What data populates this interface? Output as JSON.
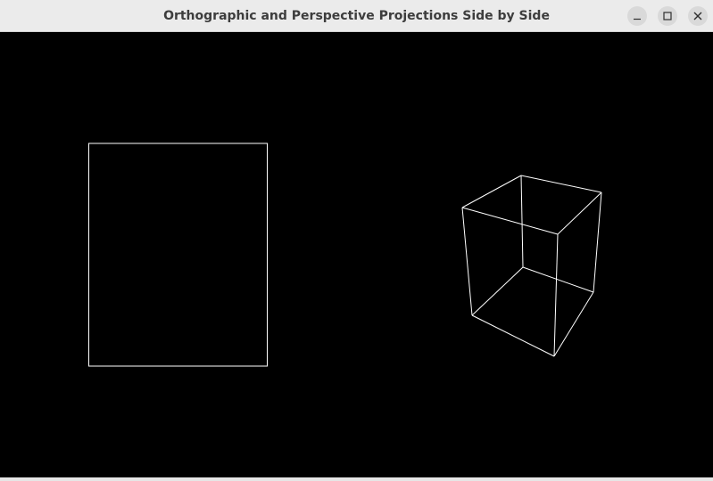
{
  "window": {
    "title": "Orthographic and Perspective Projections Side by Side"
  },
  "controls": {
    "minimize_icon": "minimize-icon",
    "maximize_icon": "maximize-icon",
    "close_icon": "close-icon"
  },
  "scene": {
    "background_color": "#000000",
    "line_color": "#ffffff",
    "left_view": "orthographic-projection",
    "right_view": "perspective-projection"
  }
}
